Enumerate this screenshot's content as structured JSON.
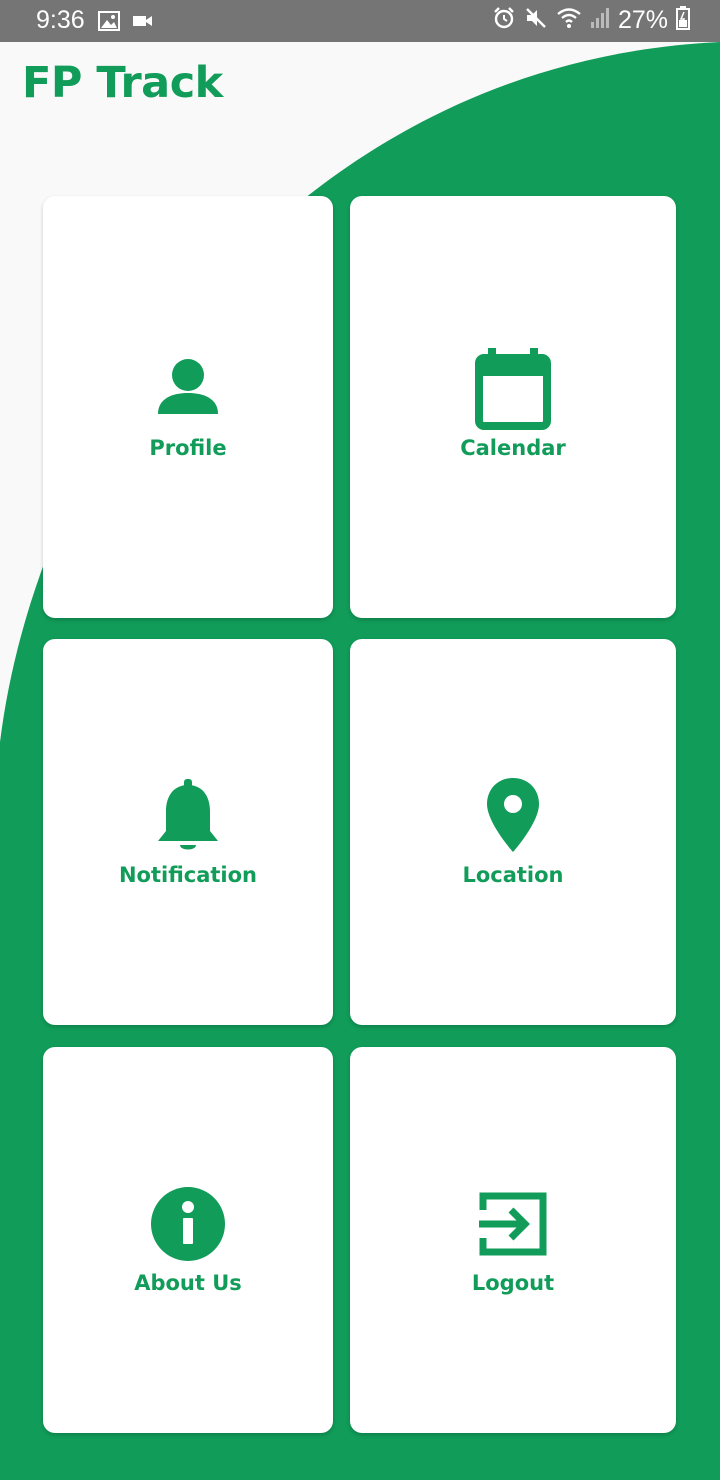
{
  "status_bar": {
    "time": "9:36",
    "battery": "27%",
    "icons": [
      "image-icon",
      "video-icon",
      "alarm-icon",
      "mute-icon",
      "wifi-icon",
      "signal-icon",
      "battery-charging-icon"
    ]
  },
  "app": {
    "title": "FP Track",
    "accent_color": "#119c59",
    "background_color": "#f9f9f9"
  },
  "menu": [
    {
      "label": "Profile",
      "icon": "person-icon"
    },
    {
      "label": "Calendar",
      "icon": "calendar-icon"
    },
    {
      "label": "Notification",
      "icon": "bell-icon"
    },
    {
      "label": "Location",
      "icon": "location-pin-icon"
    },
    {
      "label": "About Us",
      "icon": "info-icon"
    },
    {
      "label": "Logout",
      "icon": "logout-icon"
    }
  ]
}
